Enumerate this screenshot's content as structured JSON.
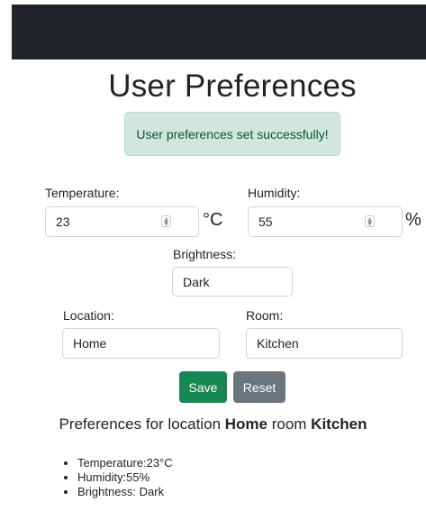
{
  "page": {
    "title": "User Preferences"
  },
  "alert": {
    "text": "User preferences set successfully!"
  },
  "form": {
    "temperature": {
      "label": "Temperature:",
      "value": "23",
      "unit": "°C"
    },
    "humidity": {
      "label": "Humidity:",
      "value": "55",
      "unit": "%"
    },
    "brightness": {
      "label": "Brightness:",
      "value": "Dark"
    },
    "location": {
      "label": "Location:",
      "value": "Home"
    },
    "room": {
      "label": "Room:",
      "value": "Kitchen"
    }
  },
  "buttons": {
    "save_label": "Save",
    "reset_label": "Reset"
  },
  "summary": {
    "prefix": "Preferences for location ",
    "location": "Home",
    "mid": " room ",
    "room": "Kitchen"
  },
  "list": {
    "items": [
      "Temperature:23°C",
      "Humidity:55%",
      "Brightness: Dark"
    ]
  },
  "colors": {
    "navbar": "#212529",
    "alert_bg": "#d1e7dd",
    "alert_text": "#0f5132",
    "save": "#198754",
    "reset": "#6c757d"
  },
  "icons": {
    "spinner": "number-stepper-icon"
  }
}
